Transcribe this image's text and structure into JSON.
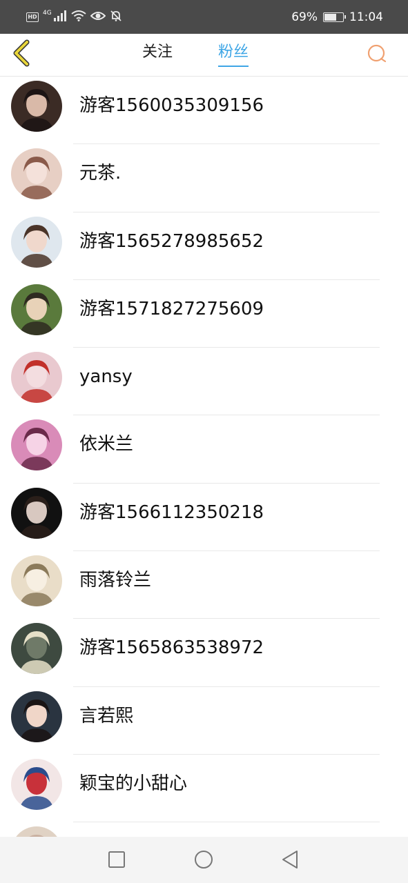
{
  "status_bar": {
    "hd_badge": "HD",
    "network": "4G",
    "battery_text": "69%",
    "battery_level": 0.69,
    "time": "11:04",
    "icons": [
      "signal-icon",
      "wifi-icon",
      "eye-icon",
      "mute-icon",
      "battery-icon"
    ]
  },
  "header": {
    "back_icon": "chevron-left-icon",
    "tabs": [
      {
        "label": "关注",
        "active": false
      },
      {
        "label": "粉丝",
        "active": true
      }
    ],
    "search_icon": "search-icon",
    "accent_color": "#3ea6e6",
    "back_color": "#e8d53a",
    "search_color": "#f0a070"
  },
  "fans": [
    {
      "name": "游客1560035309156"
    },
    {
      "name": "元茶."
    },
    {
      "name": "游客1565278985652"
    },
    {
      "name": "游客1571827275609"
    },
    {
      "name": "yansy"
    },
    {
      "name": "依米兰"
    },
    {
      "name": "游客1566112350218"
    },
    {
      "name": "雨落铃兰"
    },
    {
      "name": "游客1565863538972"
    },
    {
      "name": "言若熙"
    },
    {
      "name": "颖宝的小甜心"
    },
    {
      "name": ""
    }
  ],
  "nav_bar": {
    "icons": [
      "recent-apps-icon",
      "home-icon",
      "back-triangle-icon"
    ]
  }
}
